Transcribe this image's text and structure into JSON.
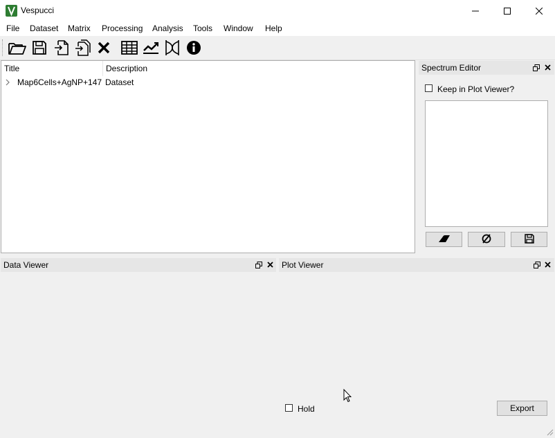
{
  "window": {
    "title": "Vespucci"
  },
  "menu": [
    "File",
    "Dataset",
    "Matrix",
    "Processing",
    "Analysis",
    "Tools",
    "Window",
    "Help"
  ],
  "tree": {
    "columns": [
      "Title",
      "Description"
    ],
    "rows": [
      {
        "title": "Map6Cells+AgNP+147",
        "description": "Dataset"
      }
    ]
  },
  "spectrum_editor": {
    "title": "Spectrum Editor",
    "keep_label": "Keep in Plot Viewer?"
  },
  "data_viewer": {
    "title": "Data Viewer"
  },
  "plot_viewer": {
    "title": "Plot Viewer",
    "hold_label": "Hold",
    "export_label": "Export"
  },
  "colors": {
    "logo": "#2e7d32",
    "dock_title_bg": "#e6e6e6"
  }
}
